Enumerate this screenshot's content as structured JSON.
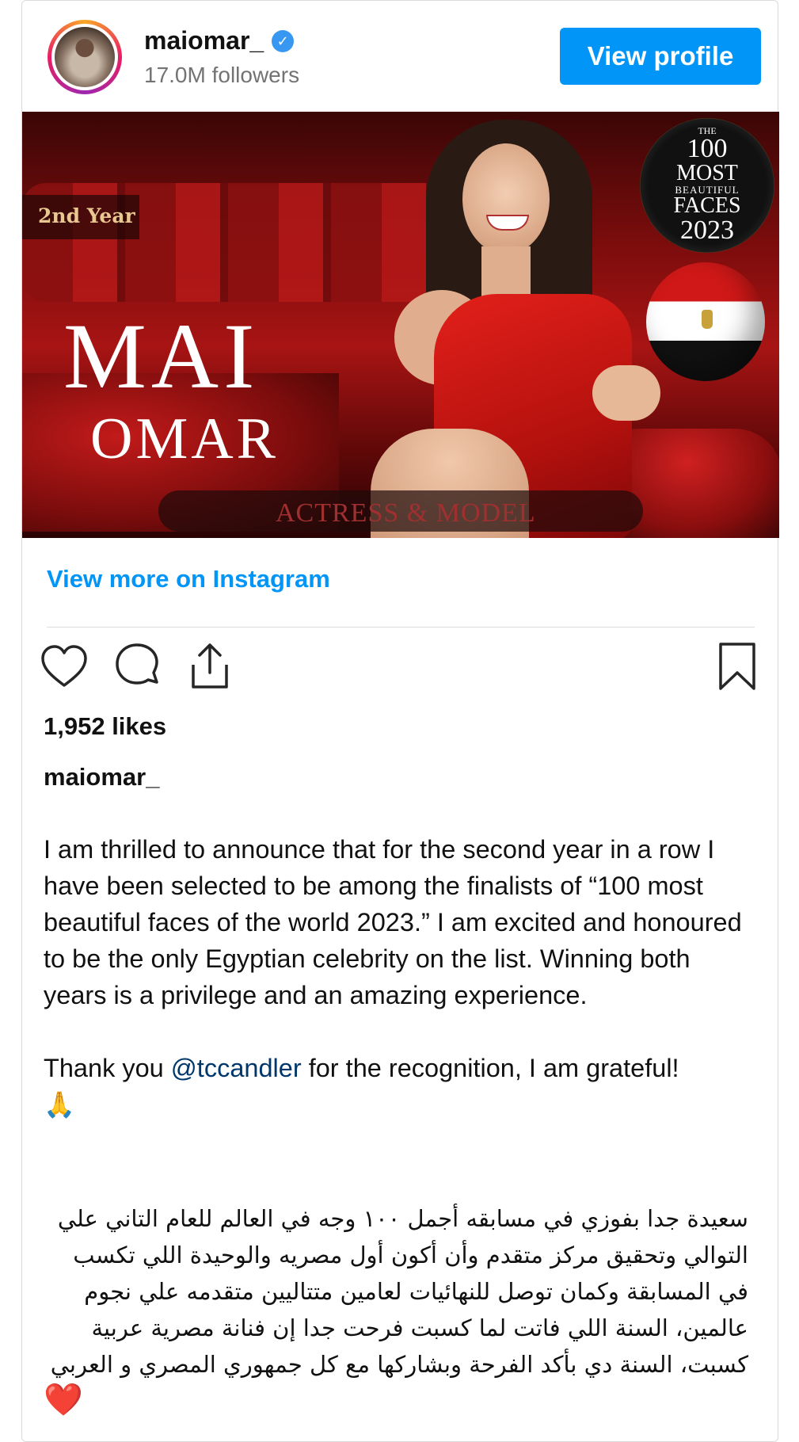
{
  "profile": {
    "username": "maiomar_",
    "followers": "17.0M followers",
    "view_profile_label": "View profile",
    "verified_symbol": "✓"
  },
  "post_image": {
    "badge": "2nd Year",
    "first_name": "MAI",
    "last_name": "OMAR",
    "tagline": "ACTRESS & MODEL",
    "seal": {
      "the": "THE",
      "number": "100",
      "most": "MOST",
      "beautiful": "BEAUTIFUL",
      "faces": "FACES",
      "year": "2023"
    }
  },
  "view_more_label": "View more on Instagram",
  "actions": {
    "like_icon": "heart-icon",
    "comment_icon": "comment-icon",
    "share_icon": "share-icon",
    "save_icon": "bookmark-icon"
  },
  "likes": "1,952 likes",
  "caption": {
    "username": "maiomar_",
    "paragraph1": "I am thrilled to announce that for the second year in a row I have been selected to be among the finalists of “100 most beautiful faces of the world 2023.” I am excited and honoured to be the only Egyptian celebrity on the list. Winning both years is a privilege and an amazing experience.",
    "thanks_prefix": "Thank you ",
    "mention": "@tccandler",
    "thanks_suffix": " for the recognition, I am grateful!",
    "pray_emoji": "🙏",
    "arabic": "سعيدة جدا بفوزي في مسابقه أجمل ١٠٠ وجه في العالم للعام التاني علي التوالي وتحقيق مركز متقدم وأن أكون أول مصريه والوحيدة اللي تكسب في المسابقة وكمان توصل للنهائيات لعامين متتاليين متقدمه علي نجوم عالمين، السنة اللي فاتت لما كسبت فرحت جدا إن فنانة مصرية عربية كسبت، السنة دي بأكد الفرحة وبشاركها مع كل جمهوري المصري و العربي",
    "heart_emoji": "❤️"
  }
}
